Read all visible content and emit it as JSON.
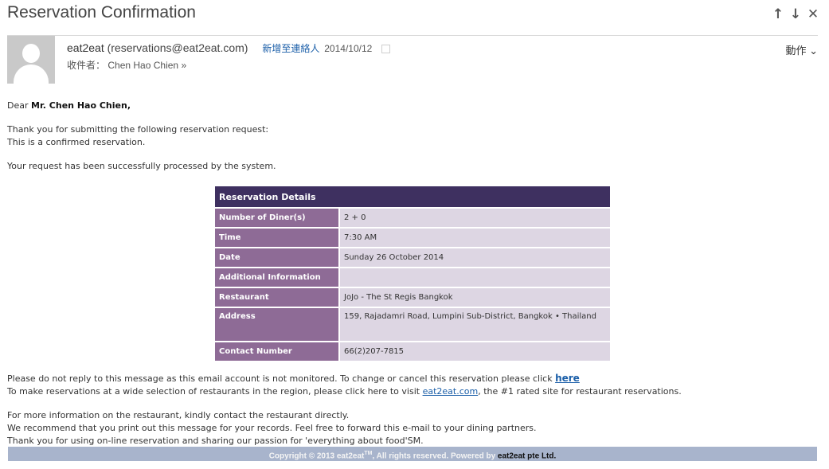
{
  "email": {
    "subject": "Reservation Confirmation",
    "sender_name": "eat2eat",
    "sender_email": "(reservations@eat2eat.com)",
    "add_contact": "新增至連絡人",
    "date": "2014/10/12",
    "to_label": "收件者：",
    "to_name": "Chen Hao Chien",
    "actions_label": "動作"
  },
  "icons": {
    "up": "↑",
    "down": "↓",
    "close": "✕",
    "expand": "»",
    "chevron": "⌄"
  },
  "body": {
    "greeting_prefix": "Dear ",
    "greeting_name": "Mr. Chen Hao Chien,",
    "line1": "Thank you for submitting the following reservation request:",
    "line2": "This is a confirmed reservation.",
    "line3": "Your request has been successfully processed by the system."
  },
  "table": {
    "header": "Reservation Details",
    "rows": [
      {
        "label": "Number of Diner(s)",
        "value": "2 + 0"
      },
      {
        "label": "Time",
        "value": "7:30 AM"
      },
      {
        "label": "Date",
        "value": "Sunday 26 October 2014"
      },
      {
        "label": "Additional Information",
        "value": ""
      },
      {
        "label": "Restaurant",
        "value": "JoJo - The St Regis Bangkok"
      },
      {
        "label": "Address",
        "value": "159, Rajadamri Road, Lumpini Sub-District, Bangkok • Thailand"
      },
      {
        "label": "Contact Number",
        "value": "66(2)207-7815"
      }
    ]
  },
  "notes": {
    "no_reply": "Please do not reply to this message as this email account is not monitored. To change or cancel this reservation please click ",
    "here_link": "here",
    "visit_prefix": "To make reservations at a wide selection of restaurants in the region, please click here to visit ",
    "site_link": "eat2eat.com",
    "visit_suffix": ", the #1 rated site for restaurant reservations.",
    "more_info": "For more information on the restaurant, kindly contact the restaurant directly.",
    "print": "We recommend that you print out this message for your records. Feel free to forward this e-mail to your dining partners.",
    "thanks": "Thank you for using on-line reservation and sharing our passion for 'everything about food'SM."
  },
  "footer": {
    "copyright": "Copyright © 2013 eat2eat",
    "tm": "TM",
    "rest": ", All rights reserved. Powered by ",
    "company": "eat2eat pte Ltd."
  }
}
